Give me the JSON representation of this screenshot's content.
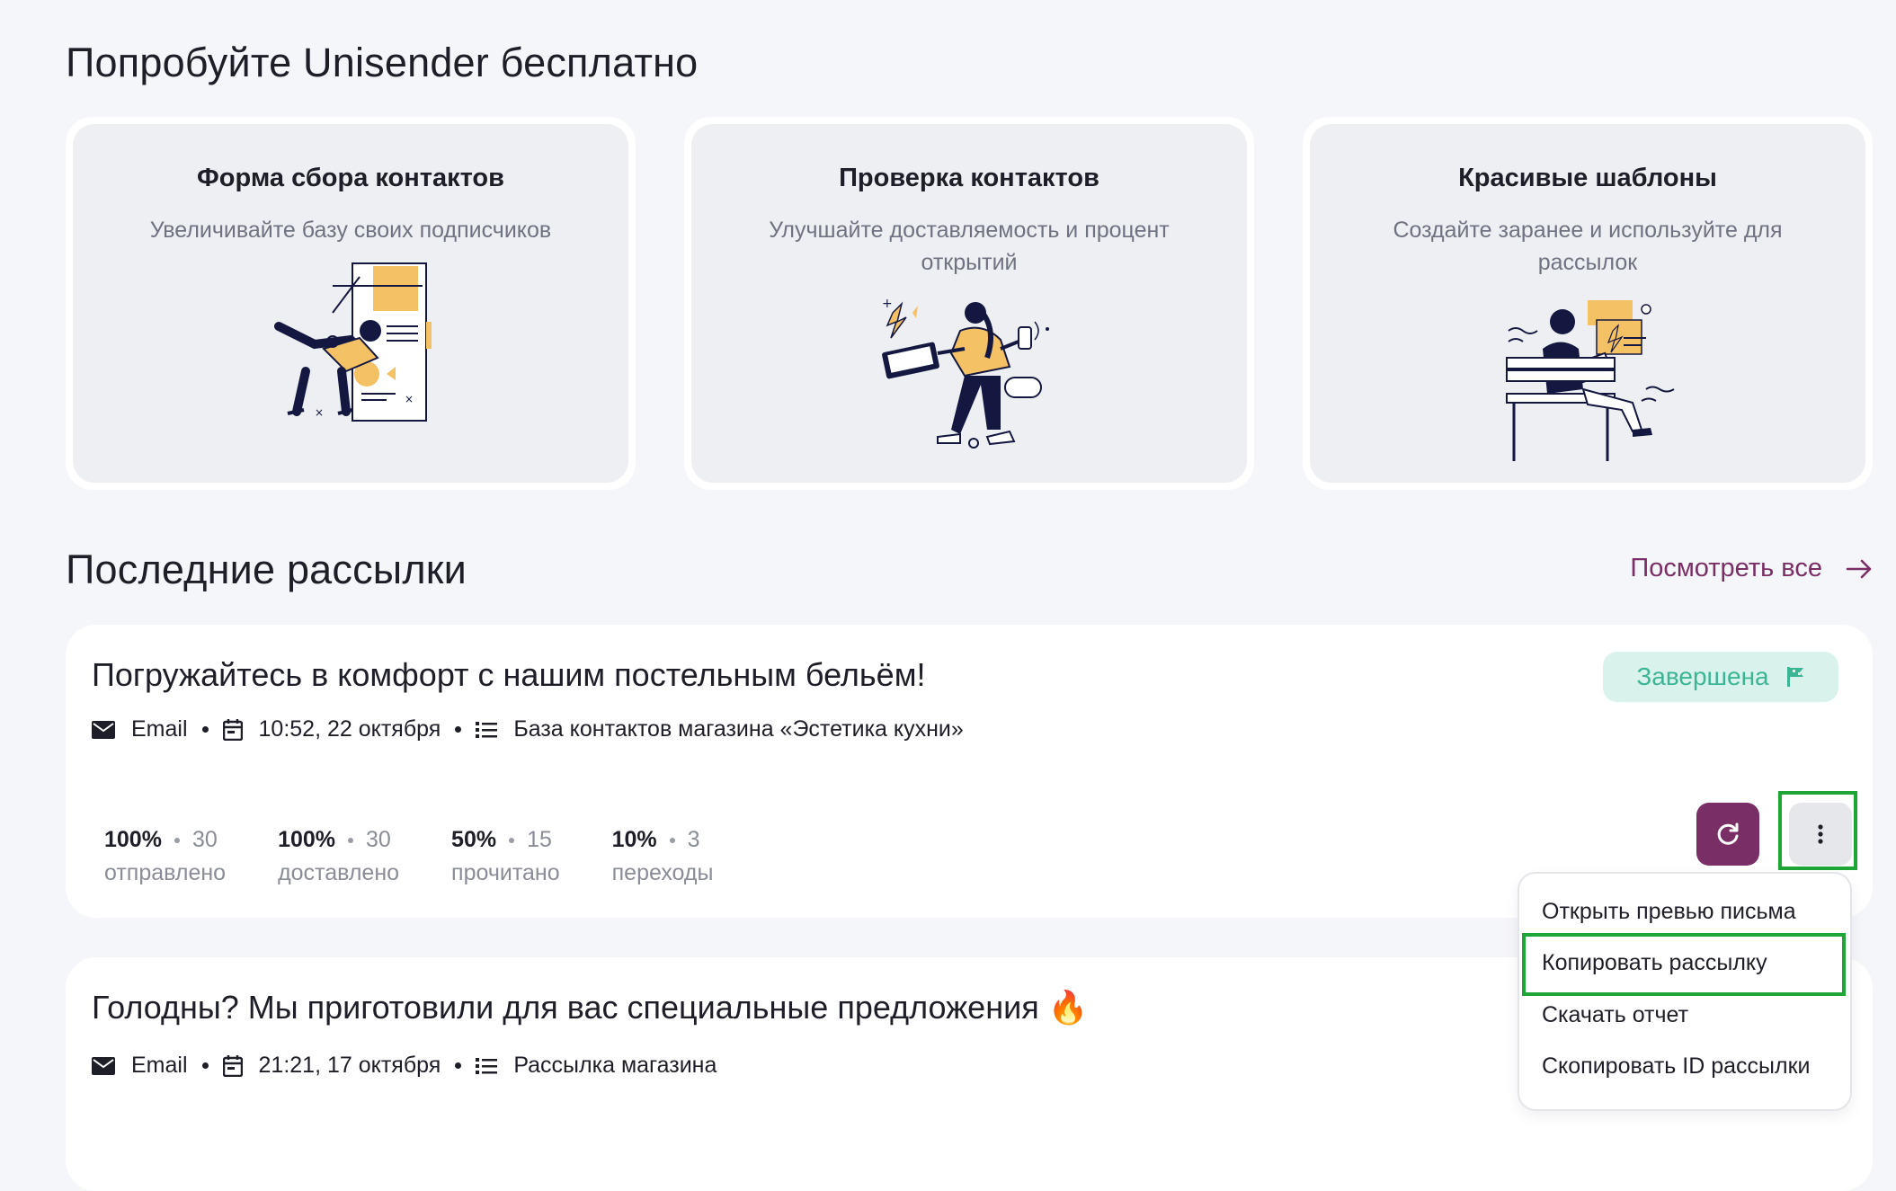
{
  "try_section": {
    "title": "Попробуйте Unisender бесплатно",
    "cards": [
      {
        "title": "Форма сбора контактов",
        "desc": "Увеличивайте базу своих подписчиков"
      },
      {
        "title": "Проверка контактов",
        "desc": "Улучшайте доставляемость и процент открытий"
      },
      {
        "title": "Красивые шаблоны",
        "desc": "Создайте заранее и используйте для рассылок"
      }
    ]
  },
  "latest": {
    "title": "Последние рассылки",
    "view_all": "Посмотреть все",
    "campaigns": [
      {
        "title": "Погружайтесь в комфорт с нашим постельным бельём!",
        "channel": "Email",
        "datetime": "10:52, 22 октября",
        "list": "База контактов магазина «Эстетика кухни»",
        "status": "Завершена",
        "stats": [
          {
            "pct": "100%",
            "count": "30",
            "label": "отправлено"
          },
          {
            "pct": "100%",
            "count": "30",
            "label": "доставлено"
          },
          {
            "pct": "50%",
            "count": "15",
            "label": "прочитано"
          },
          {
            "pct": "10%",
            "count": "3",
            "label": "переходы"
          }
        ]
      },
      {
        "title": "Голодны? Мы приготовили для вас специальные предложения 🔥",
        "channel": "Email",
        "datetime": "21:21, 17 октября",
        "list": "Рассылка магазина"
      }
    ]
  },
  "menu": {
    "items": [
      "Открыть превью письма",
      "Копировать рассылку",
      "Скачать отчет",
      "Скопировать ID рассылки"
    ]
  },
  "colors": {
    "accent": "#7a2e66",
    "status_bg": "#d9f3ec",
    "status_text": "#3cb595",
    "highlight": "#1fa636",
    "illustration_yellow": "#f5c165",
    "illustration_navy": "#141840"
  }
}
